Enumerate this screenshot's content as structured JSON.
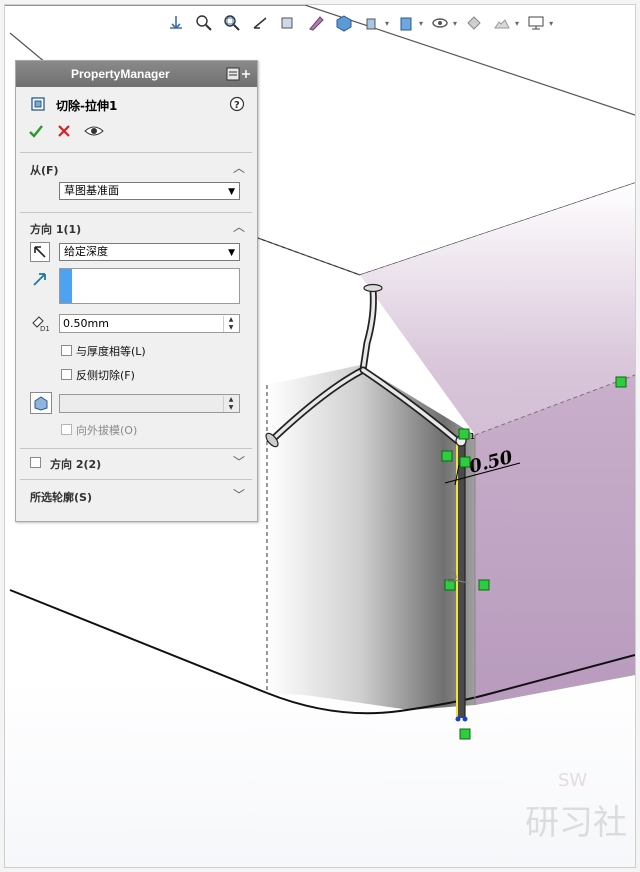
{
  "toolbar": {
    "icons": [
      "view-orientation-icon",
      "zoom-to-fit-icon",
      "zoom-area-icon",
      "previous-view-icon",
      "section-view-icon",
      "dynamic-annotation-icon",
      "view-cube-icon",
      "display-style-icon",
      "hide-show-icon",
      "edit-appearance-icon",
      "apply-scene-icon",
      "view-settings-icon"
    ]
  },
  "property_manager": {
    "title": "PropertyManager",
    "feature_name": "切除-拉伸1",
    "from": {
      "header": "从(F)",
      "selected": "草图基准面"
    },
    "direction1": {
      "header": "方向 1(1)",
      "end_condition": "给定深度",
      "depth": "0.50mm",
      "link_to_thickness": "与厚度相等(L)",
      "flip_side_to_cut": "反侧切除(F)",
      "draft_outward": "向外拔模(O)"
    },
    "direction2": {
      "header": "方向 2(2)"
    },
    "selected_contours": {
      "header": "所选轮廓(S)"
    }
  },
  "model": {
    "dimension": "0.50",
    "dim_tag": "1"
  },
  "watermark": {
    "sw": "SW",
    "text": "研习社"
  },
  "colors": {
    "face_purple": "#c5a9c8",
    "accept_green": "#2a9a2a",
    "cancel_red": "#d42222",
    "field_blue": "#4ea3f0",
    "relation_green": "#2ecc40"
  }
}
